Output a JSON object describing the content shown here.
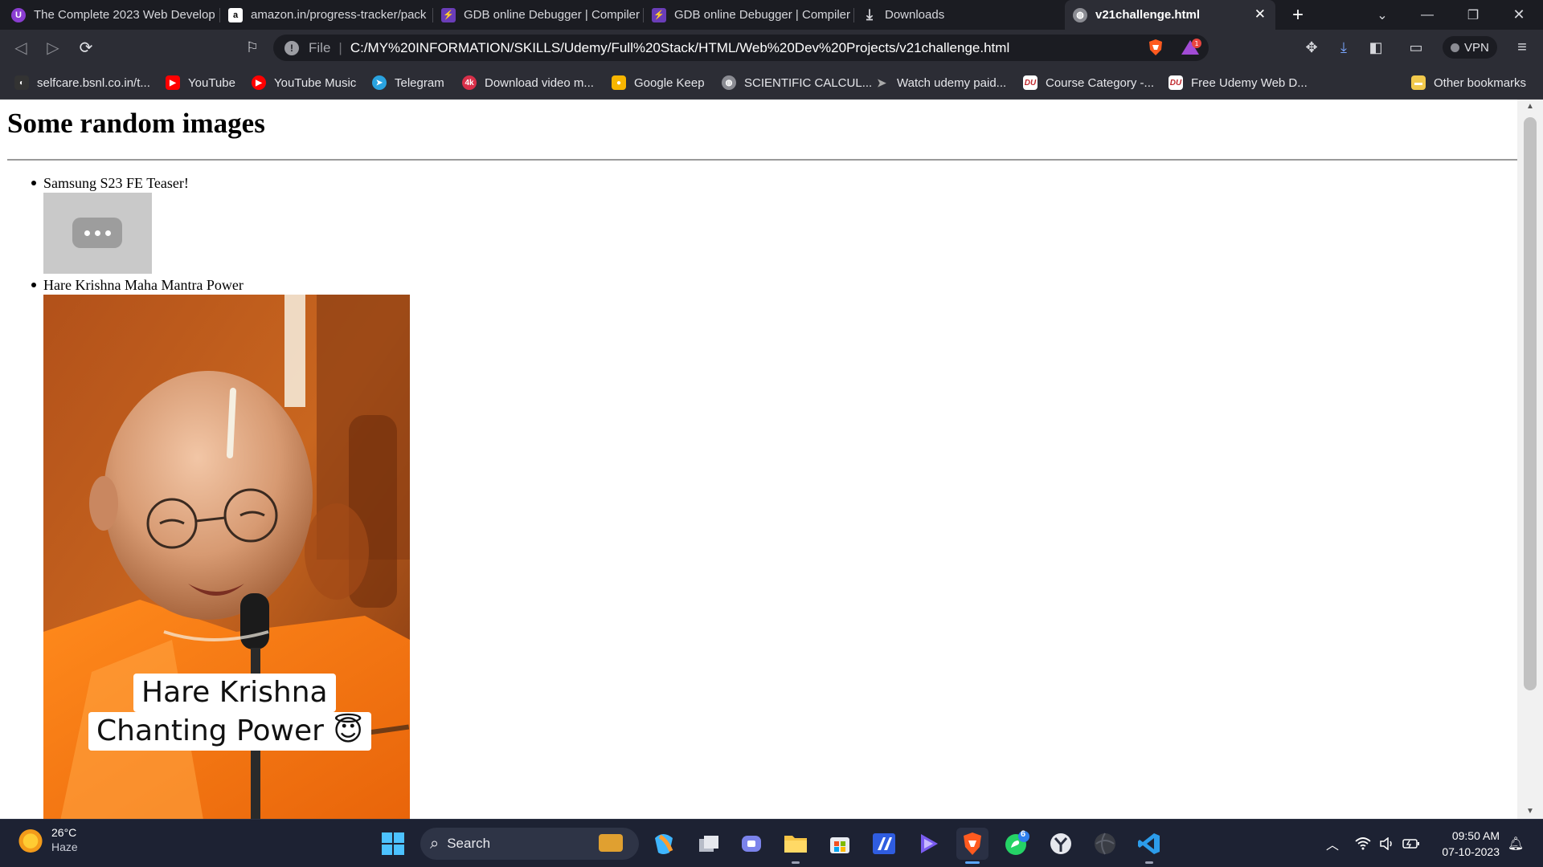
{
  "browser": {
    "tabs": [
      {
        "title": "The Complete 2023 Web Develop",
        "icon": "udemy-icon",
        "color": "#8a3dd1",
        "glyph": "U"
      },
      {
        "title": "amazon.in/progress-tracker/pack",
        "icon": "amazon-icon",
        "color": "#ffffff",
        "glyph": "a"
      },
      {
        "title": "GDB online Debugger | Compiler",
        "icon": "gdb-icon",
        "color": "#6a3db8",
        "glyph": "⚡"
      },
      {
        "title": "GDB online Debugger | Compiler",
        "icon": "gdb-icon",
        "color": "#6a3db8",
        "glyph": "⚡"
      },
      {
        "title": "Downloads",
        "icon": "download-icon",
        "color": "transparent",
        "glyph": "⤓"
      },
      {
        "title": "v21challenge.html",
        "icon": "globe-icon",
        "color": "#8b8c93",
        "glyph": "◍",
        "active": true
      }
    ],
    "new_tab": "+",
    "url_scheme": "File",
    "url": "C:/MY%20INFORMATION/SKILLS/Udemy/Full%20Stack/HTML/Web%20Dev%20Projects/v21challenge.html",
    "rewards_badge": "1",
    "vpn_label": "VPN",
    "bookmarks": [
      {
        "label": "selfcare.bsnl.co.in/t...",
        "icon": "bsnl-icon",
        "color": "#333333"
      },
      {
        "label": "YouTube",
        "icon": "youtube-icon",
        "color": "#ff0000"
      },
      {
        "label": "YouTube Music",
        "icon": "youtube-music-icon",
        "color": "#ff0000"
      },
      {
        "label": "Telegram",
        "icon": "telegram-icon",
        "color": "#2aa3e0"
      },
      {
        "label": "Download video m...",
        "icon": "4k-icon",
        "color": "#d9304a"
      },
      {
        "label": "Google Keep",
        "icon": "google-keep-icon",
        "color": "#f7b500"
      },
      {
        "label": "SCIENTIFIC CALCUL...",
        "icon": "globe-icon",
        "color": "#8b8c93"
      },
      {
        "label": "Watch udemy paid...",
        "icon": "arrow-icon",
        "color": "#2c2d35"
      },
      {
        "label": "Course Category -...",
        "icon": "du-icon",
        "color": "#ffffff"
      },
      {
        "label": "Free Udemy Web D...",
        "icon": "du-icon",
        "color": "#ffffff"
      }
    ],
    "other_bookmarks": "Other bookmarks"
  },
  "page": {
    "heading": "Some random images",
    "items": [
      {
        "label": "Samsung S23 FE Teaser!"
      },
      {
        "label": "Hare Krishna Maha Mantra Power"
      }
    ],
    "image_caption_line1": "Hare Krishna",
    "image_caption_line2": "Chanting Power 😇"
  },
  "taskbar": {
    "temperature": "26°C",
    "weather": "Haze",
    "search_label": "Search",
    "whatsapp_badge": "6",
    "time": "09:50 AM",
    "date": "07-10-2023"
  }
}
